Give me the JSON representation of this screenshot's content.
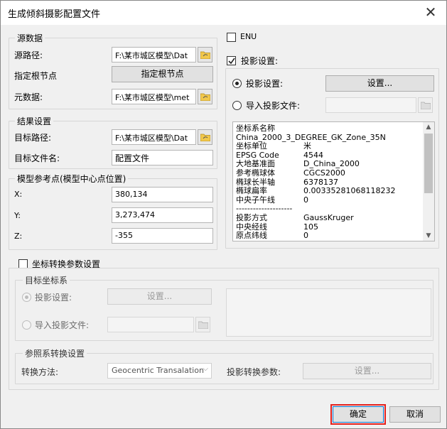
{
  "window": {
    "title": "生成倾斜摄影配置文件",
    "close": "✕"
  },
  "source": {
    "legend": "源数据",
    "path_label": "源路径:",
    "path_value": "F:\\某市城区模型\\Dat",
    "root_label": "指定根节点",
    "root_button": "指定根节点",
    "meta_label": "元数据:",
    "meta_value": "F:\\某市城区模型\\met"
  },
  "result": {
    "legend": "结果设置",
    "path_label": "目标路径:",
    "path_value": "F:\\某市城区模型\\Dat",
    "name_label": "目标文件名:",
    "name_value": "配置文件"
  },
  "refpoint": {
    "legend": "模型参考点(模型中心点位置)",
    "x_label": "X:",
    "x_value": "380,134",
    "y_label": "Y:",
    "y_value": "3,273,474",
    "z_label": "Z:",
    "z_value": "-355"
  },
  "enu": {
    "label": "ENU",
    "checked": false
  },
  "projection": {
    "legend": "投影设置:",
    "checked": true,
    "set_radio": "投影设置:",
    "set_button": "设置...",
    "import_radio": "导入投影文件:",
    "import_value": "",
    "info": [
      {
        "k": "坐标系名称",
        "v": ""
      },
      {
        "k": "China_2000_3_DEGREE_GK_Zone_35N",
        "v": ""
      },
      {
        "k": "坐标单位",
        "v": "米"
      },
      {
        "k": "EPSG Code",
        "v": "4544"
      },
      {
        "k": "大地基准面",
        "v": "D_China_2000"
      },
      {
        "k": "参考椭球体",
        "v": "CGCS2000"
      },
      {
        "k": "椭球长半轴",
        "v": "6378137"
      },
      {
        "k": "椭球扁率",
        "v": "0.00335281068118232"
      },
      {
        "k": "中央子午线",
        "v": "0"
      },
      {
        "k": "--------------------",
        "v": ""
      },
      {
        "k": "投影方式",
        "v": "GaussKruger"
      },
      {
        "k": "中央经线",
        "v": "105"
      },
      {
        "k": "原点纬线",
        "v": "0"
      }
    ]
  },
  "transform": {
    "label": "坐标转换参数设置",
    "checked": false,
    "target_legend": "目标坐标系",
    "set_radio": "投影设置:",
    "set_button": "设置...",
    "import_radio": "导入投影文件:",
    "ref_legend": "参照系转换设置",
    "method_label": "转换方法:",
    "method_value": "Geocentric Transalation",
    "param_label": "投影转换参数:",
    "param_button": "设置..."
  },
  "footer": {
    "ok": "确定",
    "cancel": "取消"
  }
}
